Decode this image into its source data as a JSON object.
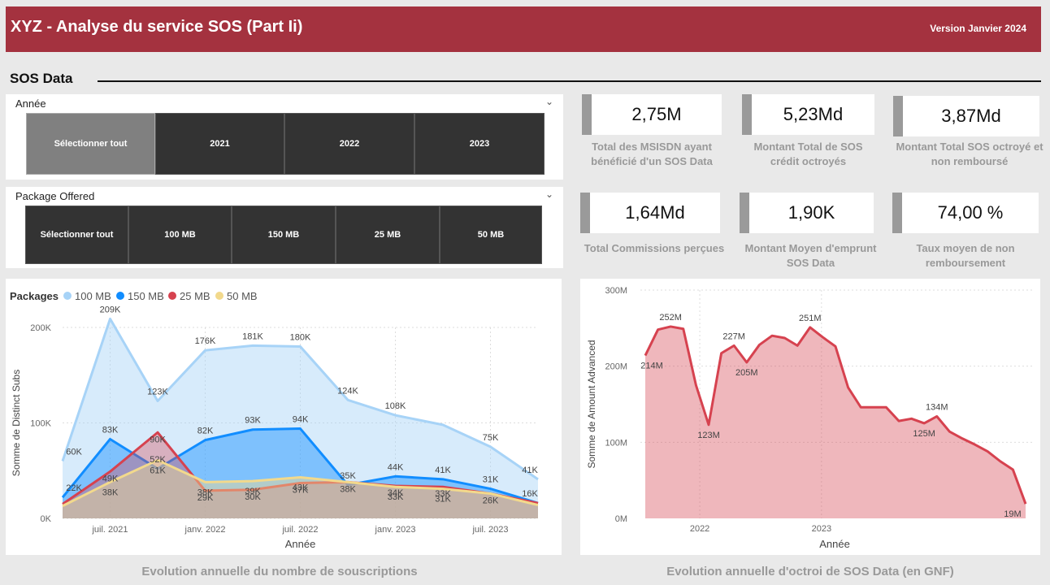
{
  "header": {
    "title": "XYZ  - Analyse du service SOS (Part Ii)",
    "version": "Version Janvier 2024"
  },
  "section": {
    "title": "SOS Data"
  },
  "slicers": {
    "annee": {
      "label": "Année",
      "options": [
        "Sélectionner tout",
        "2021",
        "2022",
        "2023"
      ],
      "selected": "Sélectionner tout"
    },
    "package": {
      "label": "Package Offered",
      "options": [
        "Sélectionner tout",
        "100 MB",
        "150 MB",
        "25 MB",
        "50 MB"
      ],
      "selected": "Sélectionner tout"
    }
  },
  "kpis": [
    {
      "value": "2,75M",
      "label": "Total des MSISDN ayant bénéficié d'un SOS Data"
    },
    {
      "value": "5,23Md",
      "label": "Montant Total de SOS crédit octroyés"
    },
    {
      "value": "3,87Md",
      "label": "Montant Total SOS octroyé et non remboursé"
    },
    {
      "value": "1,64Md",
      "label": "Total Commissions perçues"
    },
    {
      "value": "1,90K",
      "label": "Montant Moyen d'emprunt SOS Data"
    },
    {
      "value": "74,00 %",
      "label": "Taux moyen de non remboursement"
    }
  ],
  "colors": {
    "header": "#a4323f",
    "s100": "#a7d3f7",
    "s150": "#118dff",
    "s25": "#d6424f",
    "s50": "#f2d98c",
    "right": "#d6424f"
  },
  "chart_data": [
    {
      "type": "area",
      "title": "Evolution annuelle du nombre de souscriptions",
      "legend_title": "Packages",
      "xlabel": "Année",
      "ylabel": "Somme de Distinct Subs",
      "ylim": [
        0,
        200000
      ],
      "yticks": [
        "0K",
        "100K",
        "200K"
      ],
      "xticks": [
        "juil. 2021",
        "janv. 2022",
        "juil. 2022",
        "janv. 2023",
        "juil. 2023"
      ],
      "x": [
        "2021-04",
        "2021-07",
        "2021-10",
        "2022-01",
        "2022-04",
        "2022-07",
        "2022-10",
        "2023-01",
        "2023-04",
        "2023-07",
        "2023-10"
      ],
      "series": [
        {
          "name": "100 MB",
          "values": [
            60000,
            209000,
            123000,
            176000,
            181000,
            180000,
            124000,
            108000,
            98000,
            75000,
            41000
          ],
          "labels": [
            "60K",
            "209K",
            "123K",
            "176K",
            "181K",
            "180K",
            "124K",
            "108K",
            null,
            "75K",
            "41K"
          ]
        },
        {
          "name": "150 MB",
          "values": [
            22000,
            83000,
            52000,
            82000,
            93000,
            94000,
            35000,
            44000,
            41000,
            31000,
            16000
          ],
          "labels": [
            "22K",
            "83K",
            "52K",
            "82K",
            "93K",
            "94K",
            "35K",
            "44K",
            "41K",
            "31K",
            "16K"
          ]
        },
        {
          "name": "25 MB",
          "values": [
            15000,
            49000,
            90000,
            29000,
            30000,
            37000,
            38000,
            34000,
            33000,
            26000,
            16000
          ],
          "labels": [
            null,
            "49K",
            "90K",
            "29K",
            "30K",
            "37K",
            "38K",
            "34K",
            "33K",
            "26K",
            null
          ]
        },
        {
          "name": "50 MB",
          "values": [
            13000,
            38000,
            61000,
            38000,
            39000,
            43000,
            38000,
            33000,
            31000,
            26000,
            14000
          ],
          "labels": [
            null,
            "38K",
            "61K",
            "38K",
            "39K",
            "43K",
            null,
            "33K",
            "31K",
            null,
            null
          ]
        }
      ]
    },
    {
      "type": "area",
      "title": "Evolution annuelle d'octroi de SOS Data (en GNF)",
      "xlabel": "Année",
      "ylabel": "Somme de Amount Advanced",
      "ylim": [
        0,
        300000000
      ],
      "yticks": [
        "0M",
        "100M",
        "200M",
        "300M"
      ],
      "xticks": [
        "2022",
        "2023"
      ],
      "series": [
        {
          "name": "Amount Advanced",
          "values": [
            214,
            248,
            252,
            249,
            175,
            123,
            217,
            227,
            205,
            228,
            240,
            237,
            227,
            251,
            238,
            226,
            172,
            146,
            146,
            146,
            128,
            131,
            125,
            134,
            114,
            105,
            97,
            88,
            75,
            64,
            19
          ],
          "labels": [
            "214M",
            null,
            "252M",
            null,
            null,
            "123M",
            null,
            "227M",
            "205M",
            null,
            null,
            null,
            null,
            "251M",
            null,
            null,
            null,
            null,
            null,
            null,
            null,
            null,
            "125M",
            "134M",
            null,
            null,
            null,
            null,
            null,
            null,
            "19M"
          ]
        }
      ]
    }
  ]
}
